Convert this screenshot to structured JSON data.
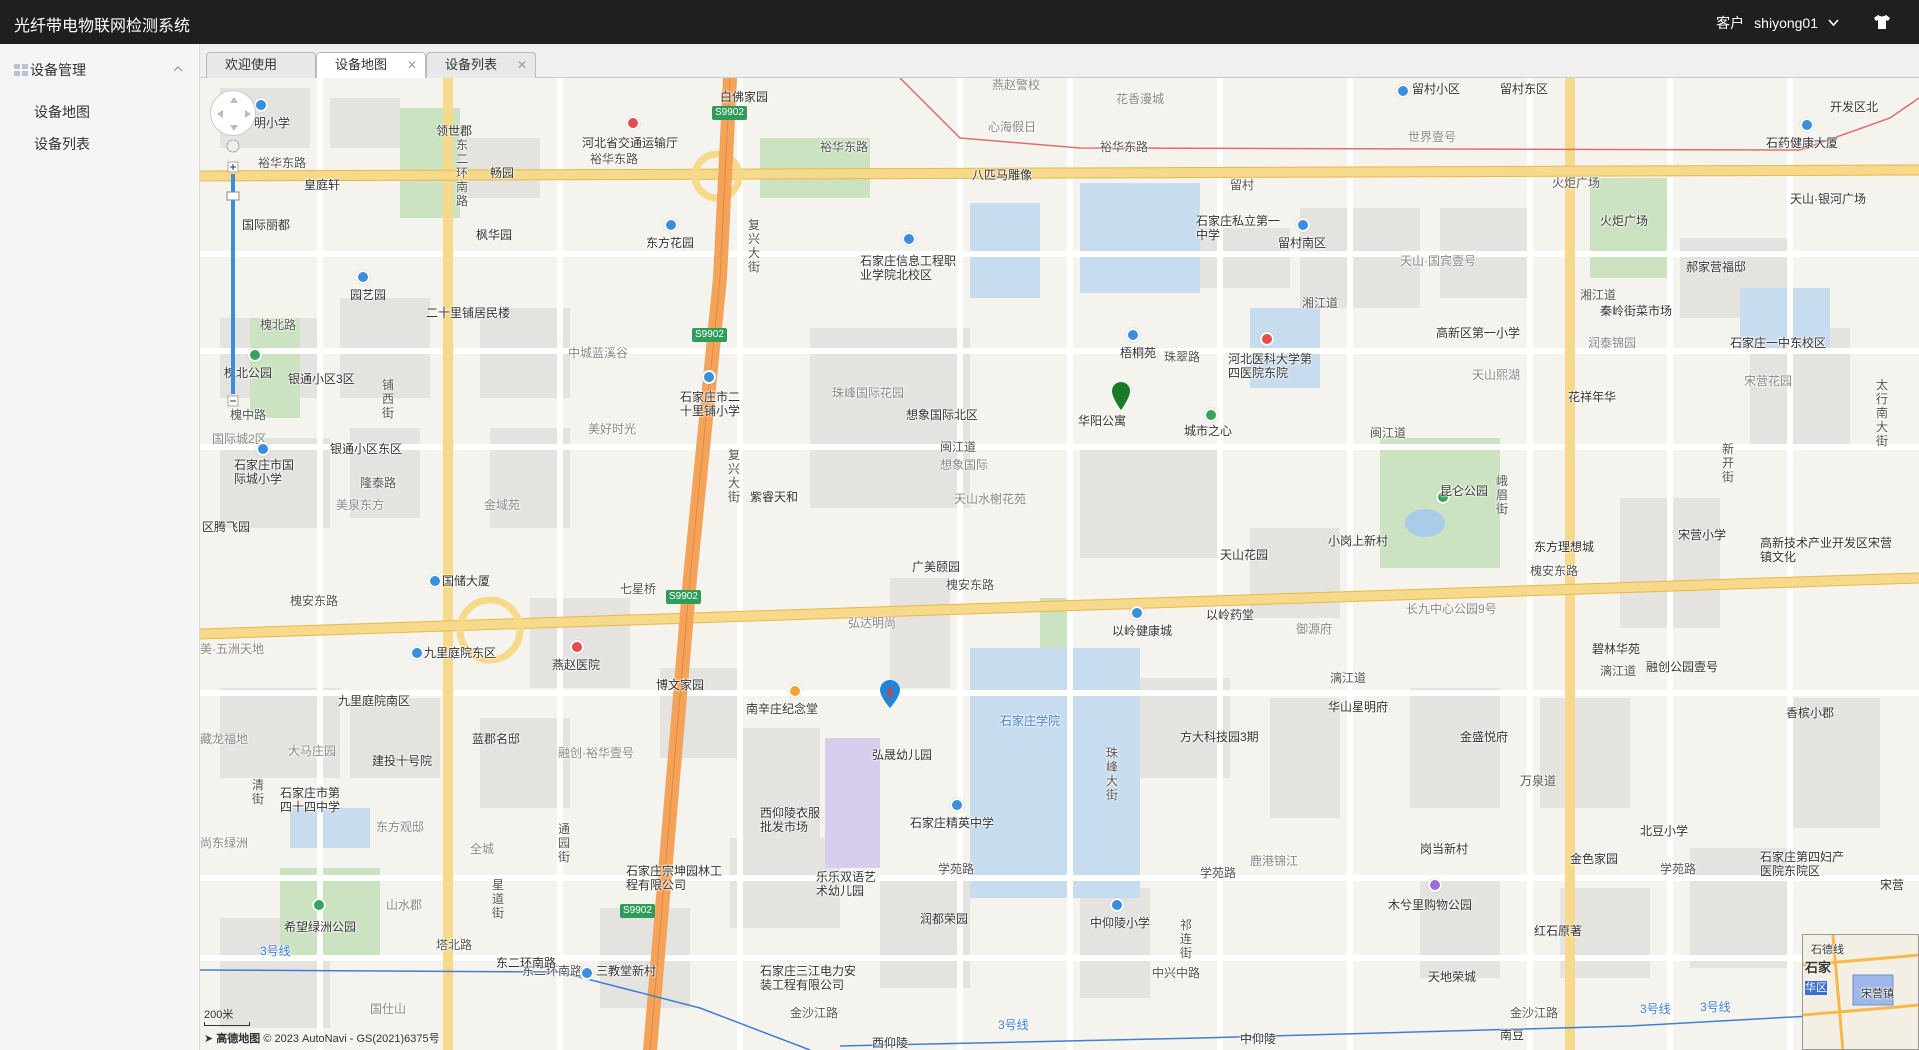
{
  "app": {
    "title": "光纤带电物联网检测系统",
    "role_label": "客户",
    "username": "shiyong01"
  },
  "sidebar": {
    "group_label": "设备管理",
    "items": [
      {
        "label": "设备地图"
      },
      {
        "label": "设备列表"
      }
    ]
  },
  "tabs": [
    {
      "label": "欢迎使用",
      "closable": false,
      "active": false
    },
    {
      "label": "设备地图",
      "closable": true,
      "active": true
    },
    {
      "label": "设备列表",
      "closable": true,
      "active": false
    }
  ],
  "map": {
    "scale_label": "200米",
    "copyright": "© 2023 AutoNavi - GS(2021)6375号",
    "brand_text": "高德地图",
    "route_badges": [
      "S9902",
      "S9902",
      "S9902",
      "S9902"
    ],
    "roads": [
      "裕华东路",
      "裕华东路",
      "裕华东路",
      "裕华东路",
      "槐安东路",
      "槐安东路",
      "槐安东路",
      "七星桥",
      "东二环南路",
      "东二环南路",
      "复兴大街",
      "复兴大街",
      "槐北路",
      "槐中路",
      "湘江道",
      "湘江道",
      "闽江道",
      "闽江道",
      "珠翠路",
      "漓江道",
      "漓江道",
      "万泉道",
      "学苑路",
      "学苑路",
      "学苑路",
      "塔北路",
      "中兴中路",
      "金沙江路",
      "金沙江路",
      "3号线",
      "3号线",
      "3号线",
      "3号线",
      "隆泰路",
      "铺西街",
      "星道街",
      "通园街",
      "清街",
      "祁连街",
      "峨眉街",
      "新开街",
      "珠峰大街",
      "太行南大街",
      "留村",
      "火炬广场"
    ],
    "places": [
      "白佛家园",
      "燕赵警校",
      "花香漫城",
      "留村小区",
      "留村东区",
      "开发区北",
      "明小学",
      "领世郡",
      "河北省交通运输厅",
      "心海假日",
      "世界壹号",
      "石药健康大厦",
      "皇庭轩",
      "畅园",
      "八匹马雕像",
      "枫华园",
      "东方花园",
      "国际丽都",
      "石家庄信息工程职业学院北校区",
      "石家庄私立第一中学",
      "留村南区",
      "天山·银河广场",
      "火炬广场",
      "天山·国宾壹号",
      "郝家营福邸",
      "园艺园",
      "二十里铺居民楼",
      "中城蓝溪谷",
      "石家庄市二十里铺小学",
      "梧桐苑",
      "河北医科大学第四医院东院",
      "高新区第一小学",
      "秦岭街菜市场",
      "石家庄一中东校区",
      "润泰锦园",
      "宋营花园",
      "天山熙湖",
      "槐北公园",
      "银通小区3区",
      "珠峰国际花园",
      "想象国际北区",
      "华阳公寓",
      "城市之心",
      "花祥年华",
      "美好时光",
      "国际城2区",
      "石家庄市国际城小学",
      "银通小区东区",
      "紫睿天和",
      "想象国际",
      "昆仑公园",
      "东方理想城",
      "宋营小学",
      "高新技术产业开发区宋营镇文化",
      "美泉东方",
      "金域苑",
      "天山水榭花苑",
      "小岗上新村",
      "天山花园",
      "区腾飞园",
      "国储大厦",
      "广美颐园",
      "以岭健康城",
      "以岭药堂",
      "长九中心公园9号",
      "御源府",
      "碧林华苑",
      "美·五洲天地",
      "九里庭院东区",
      "燕赵医院",
      "弘达明尚",
      "博文家园",
      "融创公园壹号",
      "九里庭院南区",
      "南辛庄纪念堂",
      "石家庄学院",
      "华山星明府",
      "香槟小郡",
      "藏龙福地",
      "大马庄园",
      "建投十号院",
      "蓝郡名邸",
      "融创·裕华壹号",
      "弘晟幼儿园",
      "方大科技园3期",
      "金盛悦府",
      "石家庄市第四十四中学",
      "东方观邸",
      "全城",
      "西仰陵衣服批发市场",
      "石家庄精英中学",
      "岗当新村",
      "北豆小学",
      "金色家园",
      "石家庄第四妇产医院东院区",
      "宋营",
      "尚东绿洲",
      "鹿港锦江",
      "山水郡",
      "希望绿洲公园",
      "石家庄宗坤园林工程有限公司",
      "乐乐双语艺术幼儿园",
      "润都荣园",
      "中仰陵小学",
      "木兮里购物公园",
      "红石原著",
      "天地荣城",
      "东二环南路",
      "三教堂新村",
      "石家庄三江电力安装工程有限公司",
      "国仕山",
      "西仰陵",
      "中仰陵",
      "南豆"
    ],
    "eagle_labels": [
      "石德线",
      "石家",
      "华区",
      "宋营镇"
    ]
  }
}
